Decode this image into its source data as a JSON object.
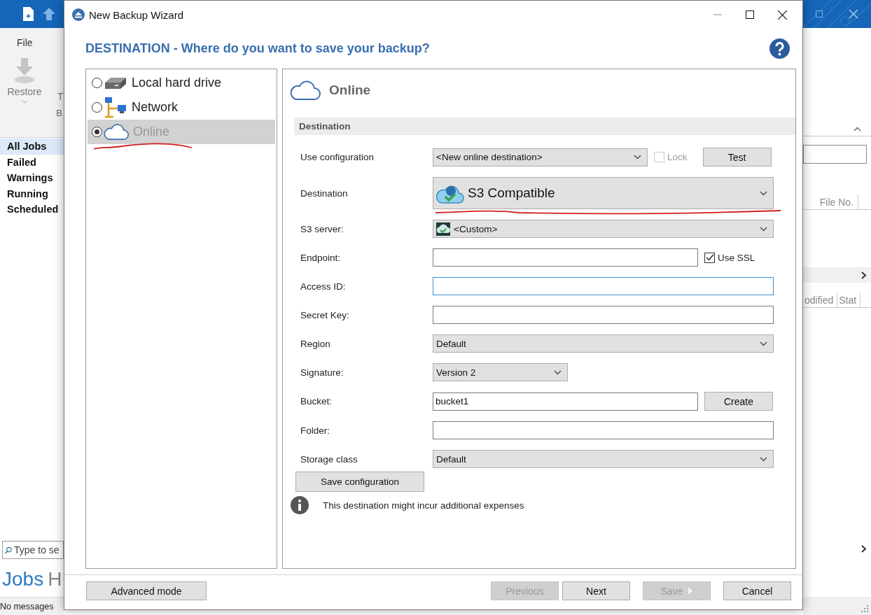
{
  "background_app": {
    "menu": "File",
    "ribbon_buttons": [
      {
        "label": "Restore",
        "kind": "restore"
      },
      {
        "label": "T",
        "kind": "cut"
      }
    ],
    "group_label": "B",
    "sidebar": {
      "items": [
        {
          "label": "All Jobs",
          "selected": true
        },
        {
          "label": "Failed",
          "selected": false
        },
        {
          "label": "Warnings",
          "selected": false
        },
        {
          "label": "Running",
          "selected": false
        },
        {
          "label": "Scheduled",
          "selected": false
        }
      ]
    },
    "search": {
      "placeholder": "Type to se"
    },
    "tabs": [
      {
        "label": "Jobs",
        "selected": true
      },
      {
        "label": "H",
        "selected": false
      }
    ],
    "status_bar": "No messages",
    "file_list": {
      "columns": [
        "File No."
      ]
    },
    "details_list": {
      "columns": [
        "odified",
        "Stat"
      ]
    }
  },
  "dialog": {
    "title": "New Backup Wizard",
    "heading": "DESTINATION - Where do you want to save your backup?",
    "destinations": [
      {
        "label": "Local hard drive",
        "kind": "drive",
        "selected": false
      },
      {
        "label": "Network",
        "kind": "network",
        "selected": false
      },
      {
        "label": "Online",
        "kind": "cloud",
        "selected": true
      }
    ],
    "panel": {
      "title": "Online",
      "section": "Destination",
      "rows": [
        {
          "label": "Use configuration",
          "control": {
            "kind": "select",
            "value": "<New online destination>"
          },
          "extras": [
            {
              "kind": "checkbox",
              "label": "Lock",
              "checked": false,
              "disabled": true
            },
            {
              "kind": "button",
              "label": "Test"
            }
          ]
        },
        {
          "label": "Destination",
          "control": {
            "kind": "service_select",
            "value": "S3 Compatible"
          },
          "extras": []
        },
        {
          "label": "S3 server:",
          "control": {
            "kind": "icon_select",
            "value": "<Custom>"
          },
          "extras": []
        },
        {
          "label": "Endpoint:",
          "control": {
            "kind": "input",
            "focused": false
          },
          "extras": [
            {
              "kind": "checkbox",
              "label": "Use SSL",
              "checked": true,
              "disabled": false
            }
          ]
        },
        {
          "label": "Access ID:",
          "control": {
            "kind": "input",
            "focused": true
          },
          "extras": []
        },
        {
          "label": "Secret Key:",
          "control": {
            "kind": "input",
            "focused": false
          },
          "extras": []
        },
        {
          "label": "Region",
          "control": {
            "kind": "select",
            "value": "Default"
          },
          "extras": []
        },
        {
          "label": "Signature:",
          "control": {
            "kind": "compact_select",
            "value": "Version 2"
          },
          "extras": []
        },
        {
          "label": "Bucket:",
          "control": {
            "kind": "input",
            "value": "bucket1",
            "focused": false
          },
          "extras": [
            {
              "kind": "button",
              "label": "Create"
            }
          ]
        },
        {
          "label": "Folder:",
          "control": {
            "kind": "input",
            "focused": false
          },
          "extras": []
        },
        {
          "label": "Storage class",
          "control": {
            "kind": "select",
            "value": "Default"
          },
          "extras": []
        }
      ],
      "save_button": "Save configuration",
      "notice": "This destination might incur additional expenses"
    },
    "footer": {
      "advanced_button": "Advanced mode",
      "buttons": [
        {
          "label": "Previous",
          "disabled": true,
          "kind": "plain"
        },
        {
          "label": "Next",
          "disabled": false,
          "kind": "plain"
        },
        {
          "label": "Save",
          "disabled": true,
          "kind": "split"
        },
        {
          "label": "Cancel",
          "disabled": false,
          "kind": "plain"
        }
      ]
    }
  }
}
